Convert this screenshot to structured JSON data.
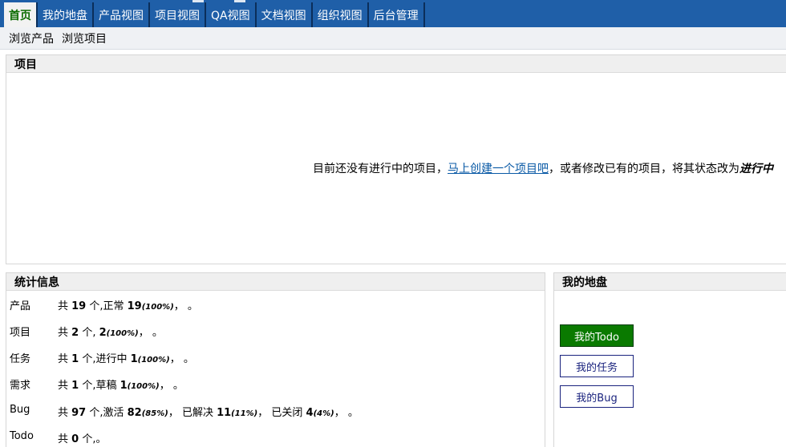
{
  "nav": {
    "items": [
      "首页",
      "我的地盘",
      "产品视图",
      "项目视图",
      "QA视图",
      "文档视图",
      "组织视图",
      "后台管理"
    ],
    "active": 0
  },
  "subnav": [
    "浏览产品",
    "浏览项目"
  ],
  "projects": {
    "title": "项目",
    "empty_before": "目前还没有进行中的项目，",
    "create_link": "马上创建一个项目吧",
    "empty_after": "，或者修改已有的项目，将其状态改为",
    "status_word": "进行中"
  },
  "stats": {
    "title": "统计信息",
    "rows": {
      "product": {
        "label": "产品",
        "a": "共 ",
        "b": "19",
        "c": " 个,正常 ",
        "d": "19",
        "e": "(100%)",
        "f": "，  。"
      },
      "project": {
        "label": "项目",
        "a": "共 ",
        "b": "2",
        "c": " 个, ",
        "d": "2",
        "e": "(100%)",
        "f": "，  。"
      },
      "task": {
        "label": "任务",
        "a": "共 ",
        "b": "1",
        "c": " 个,进行中 ",
        "d": "1",
        "e": "(100%)",
        "f": "，  。"
      },
      "story": {
        "label": "需求",
        "a": "共 ",
        "b": "1",
        "c": " 个,草稿 ",
        "d": "1",
        "e": "(100%)",
        "f": "，  。"
      },
      "bug": {
        "label": "Bug",
        "a": "共 ",
        "b": "97",
        "c": " 个,激活 ",
        "d": "82",
        "e": "(85%)",
        "f": "，  已解决 ",
        "g": "11",
        "h": "(11%)",
        "i": "，  已关闭 ",
        "j": "4",
        "k": "(4%)",
        "l": "，  。"
      },
      "todo": {
        "label": "Todo",
        "a": "共 ",
        "b": "0",
        "c": " 个,。"
      }
    }
  },
  "mydesk": {
    "title": "我的地盘",
    "buttons": [
      "我的Todo",
      "我的任务",
      "我的Bug"
    ]
  }
}
